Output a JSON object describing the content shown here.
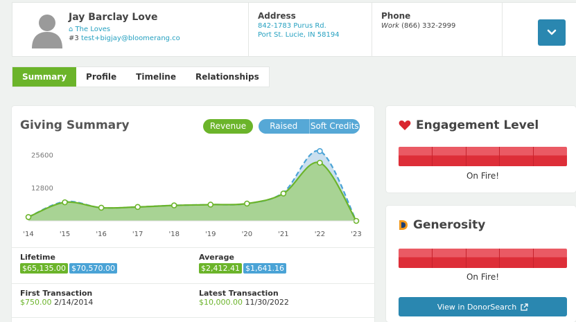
{
  "header": {
    "name": "Jay Barclay Love",
    "household": "The Loves",
    "id_prefix": "#3",
    "email": "test+bigjay@bloomerang.co",
    "address": {
      "title": "Address",
      "line1": "842-1783 Purus Rd.",
      "line2": "Port St. Lucie, IN 58194"
    },
    "phone": {
      "title": "Phone",
      "type": "Work",
      "number": "(866) 332-2999"
    }
  },
  "tabs": [
    {
      "label": "Summary",
      "active": true
    },
    {
      "label": "Profile",
      "active": false
    },
    {
      "label": "Timeline",
      "active": false
    },
    {
      "label": "Relationships",
      "active": false
    }
  ],
  "giving": {
    "title": "Giving Summary",
    "toggle_revenue": "Revenue",
    "toggle_raised": "Raised",
    "toggle_soft": "Soft Credits",
    "lifetime": {
      "label": "Lifetime",
      "revenue": "$65,135.00",
      "raised": "$70,570.00"
    },
    "average": {
      "label": "Average",
      "revenue": "$2,412.41",
      "raised": "$1,641.16"
    },
    "first": {
      "label": "First Transaction",
      "amount": "$750.00",
      "date": "2/14/2014"
    },
    "latest": {
      "label": "Latest Transaction",
      "amount": "$10,000.00",
      "date": "11/30/2022"
    }
  },
  "chart_data": {
    "type": "area",
    "categories": [
      "'14",
      "'15",
      "'16",
      "'17",
      "'18",
      "'19",
      "'20",
      "'21",
      "'22",
      "'23"
    ],
    "yticks": [
      12800,
      25600
    ],
    "ylim": [
      0,
      30000
    ],
    "series": [
      {
        "name": "Revenue",
        "color": "#6bb42a",
        "values": [
          1500,
          7200,
          5100,
          5400,
          6000,
          6300,
          6700,
          10600,
          22500,
          0
        ]
      },
      {
        "name": "Raised",
        "color": "#4aa3d6",
        "values": [
          1500,
          7500,
          5100,
          5400,
          6000,
          6300,
          6700,
          11000,
          27000,
          0
        ]
      }
    ],
    "xlabel": "",
    "ylabel": ""
  },
  "engagement": {
    "title": "Engagement Level",
    "level": "On Fire!",
    "segments": 5
  },
  "generosity": {
    "title": "Generosity",
    "level": "On Fire!",
    "segments": 5,
    "button": "View in DonorSearch"
  },
  "colors": {
    "accent_green": "#6bb42a",
    "accent_blue": "#4aa3d6",
    "button_blue": "#2a87b0",
    "fire_red": "#dd2e38",
    "heart_red": "#d9252f"
  }
}
